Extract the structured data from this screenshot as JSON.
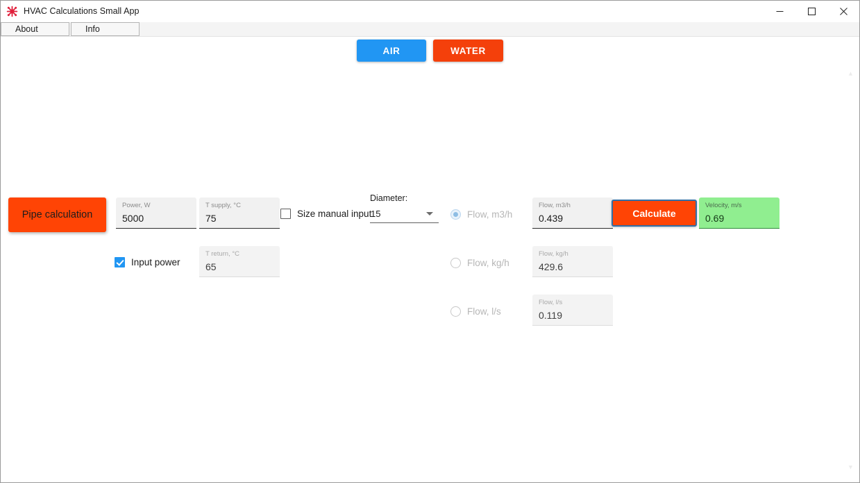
{
  "window": {
    "title": "HVAC Calculations Small App",
    "icon": "app-snowflake-icon",
    "controls": {
      "minimize": "–",
      "maximize": "☐",
      "close": "✕"
    }
  },
  "menubar": {
    "items": [
      {
        "label": "About"
      },
      {
        "label": "Info"
      }
    ]
  },
  "modes": {
    "air": {
      "label": "AIR",
      "color": "#2196f3"
    },
    "water": {
      "label": "WATER",
      "color": "#f4400b"
    }
  },
  "pipe_button": {
    "label": "Pipe calculation",
    "color": "#ff4405"
  },
  "inputs": {
    "power": {
      "label": "Power, W",
      "value": "5000"
    },
    "tsupply": {
      "label": "T supply, °C",
      "value": "75"
    },
    "treturn": {
      "label": "T return, °C",
      "value": "65"
    }
  },
  "checkboxes": {
    "size_manual": {
      "label": "Size manual input",
      "checked": false
    },
    "input_power": {
      "label": "Input power",
      "checked": true
    }
  },
  "diameter": {
    "label": "Diameter:",
    "value": "15",
    "caret": "chevron-down-icon"
  },
  "flow_radios": [
    {
      "label": "Flow, m3/h",
      "selected": true
    },
    {
      "label": "Flow, kg/h",
      "selected": false
    },
    {
      "label": "Flow, l/s",
      "selected": false
    }
  ],
  "flow_fields": {
    "m3h": {
      "label": "Flow, m3/h",
      "value": "0.439"
    },
    "kgh": {
      "label": "Flow, kg/h",
      "value": "429.6"
    },
    "ls": {
      "label": "Flow, l/s",
      "value": "0.119"
    }
  },
  "calculate_button": {
    "label": "Calculate",
    "color": "#ff4405"
  },
  "result": {
    "velocity": {
      "label": "Velocity, m/s",
      "value": "0.69",
      "color": "#90ee90"
    }
  },
  "scrollbar": {
    "up": "▲",
    "down": "▼"
  }
}
